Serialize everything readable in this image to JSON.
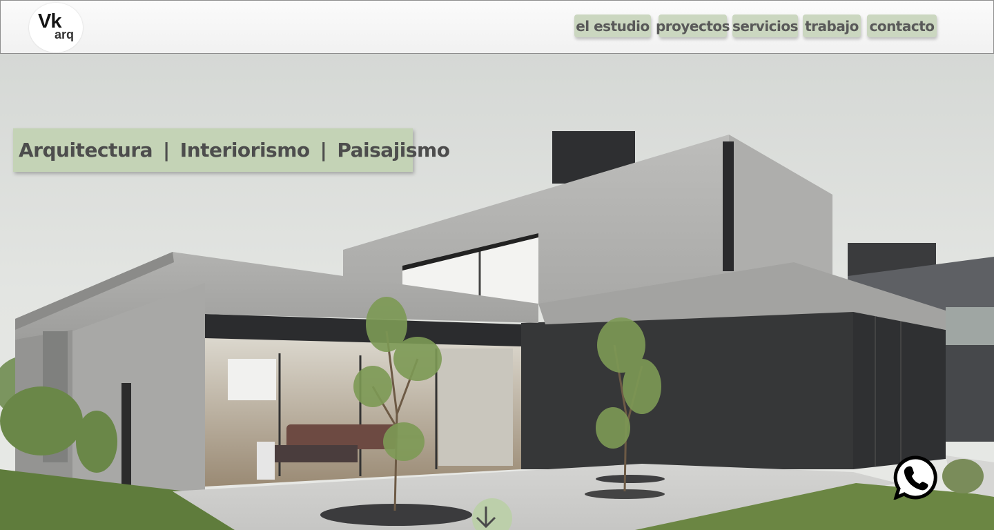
{
  "header": {
    "logo": {
      "main": "Vk",
      "sub": "arq"
    },
    "nav": [
      {
        "label": "el estudio"
      },
      {
        "label": "proyectos"
      },
      {
        "label": "servicios"
      },
      {
        "label": "trabajo"
      },
      {
        "label": "contacto"
      }
    ]
  },
  "hero": {
    "tagline": {
      "part1": "Arquitectura",
      "sep1": "|",
      "part2": "Interiorismo",
      "sep2": "|",
      "part3": "Paisajismo"
    },
    "image_subject": "modern concrete house with large glass windows",
    "whatsapp_icon": "whatsapp-icon",
    "scroll_icon": "arrow-down-icon"
  },
  "colors": {
    "nav_bg": "#cbd7c0",
    "tagline_bg": "#c4d3b6",
    "nav_text": "#595959",
    "scroll_button": "#bccfaa"
  }
}
